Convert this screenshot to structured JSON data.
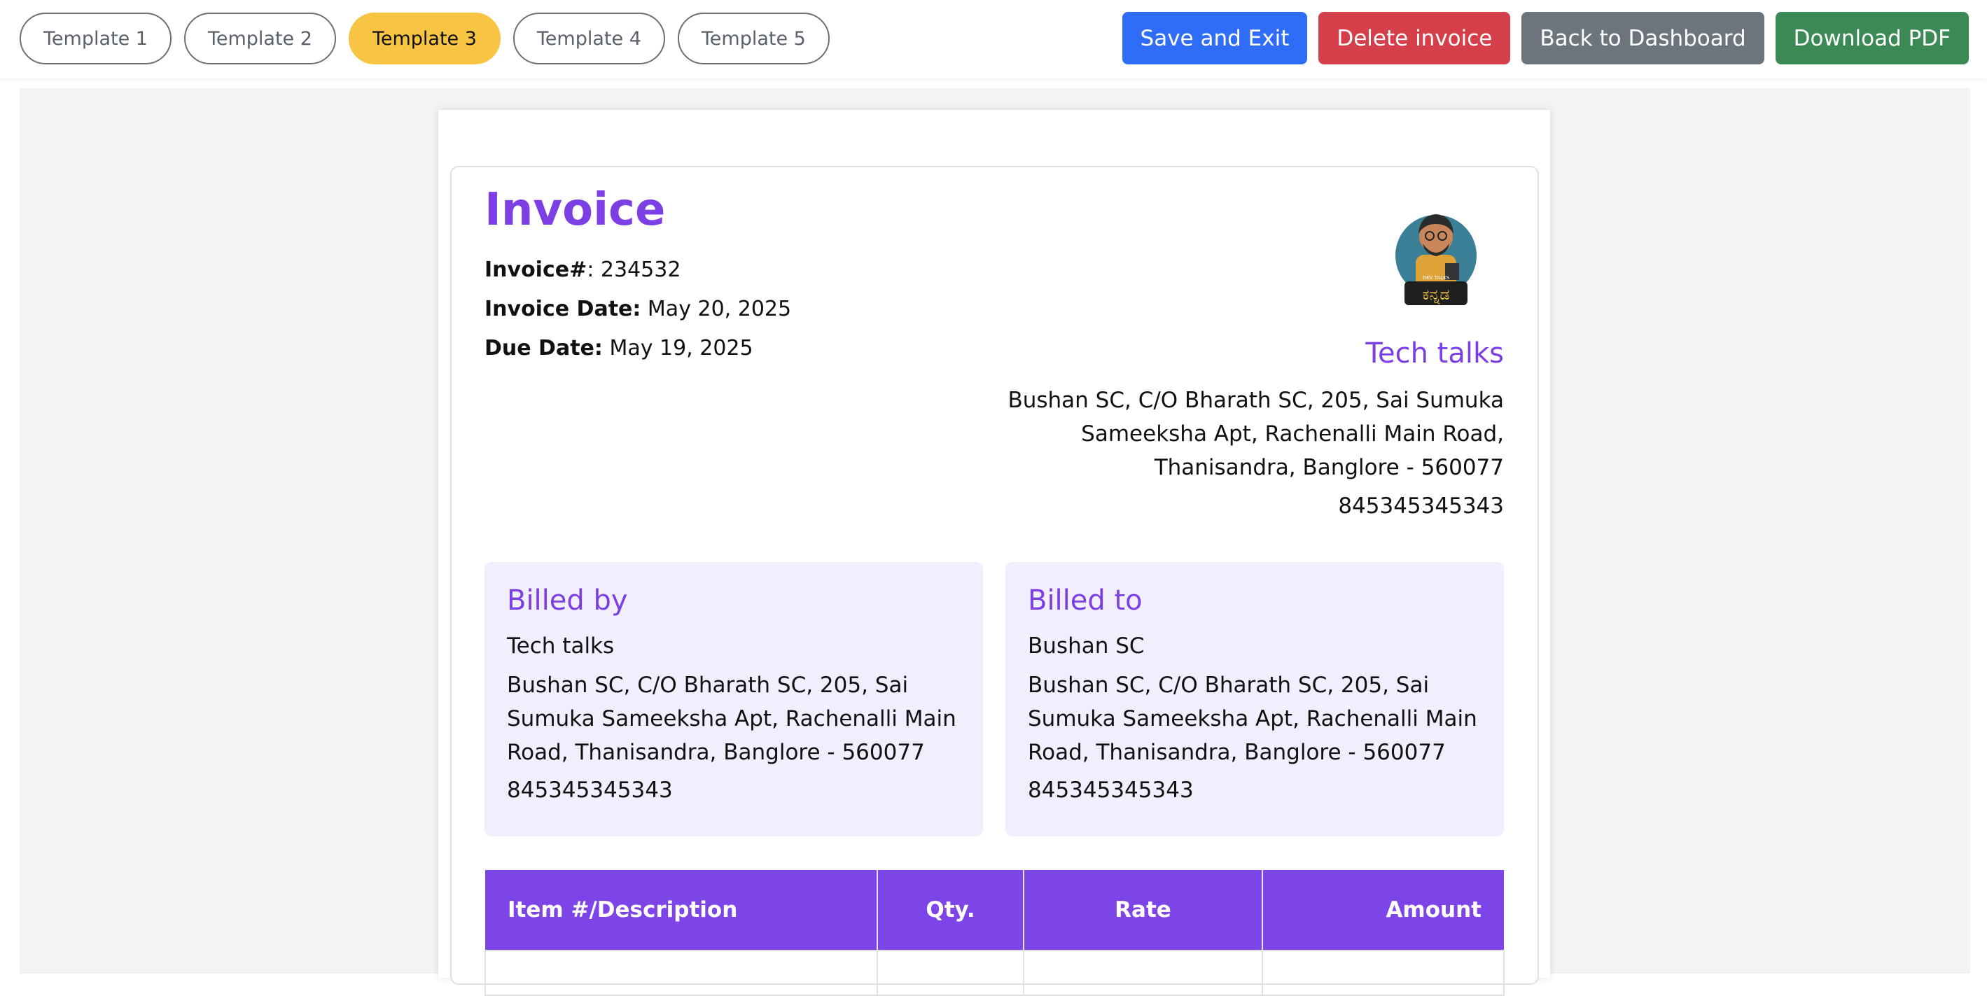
{
  "templates": [
    "Template 1",
    "Template 2",
    "Template 3",
    "Template 4",
    "Template 5"
  ],
  "active_template": "Template 3",
  "actions": {
    "save_exit": "Save and Exit",
    "delete_invoice": "Delete invoice",
    "back_dashboard": "Back to Dashboard",
    "download_pdf": "Download PDF"
  },
  "invoice": {
    "title": "Invoice",
    "number_label": "Invoice#",
    "number": "234532",
    "date_label": "Invoice Date:",
    "date": "May 20, 2025",
    "due_label": "Due Date:",
    "due": "May 19, 2025"
  },
  "company": {
    "name": "Tech talks",
    "address": "Bushan SC, C/O Bharath SC, 205, Sai Sumuka Sameeksha Apt, Rachenalli Main Road, Thanisandra, Banglore - 560077",
    "phone": "845345345343",
    "logo_text_top": "DEV TALKS",
    "logo_text": "ಕನ್ನಡ"
  },
  "billed_by": {
    "heading": "Billed by",
    "name": "Tech talks",
    "address": "Bushan SC, C/O Bharath SC, 205, Sai Sumuka Sameeksha Apt, Rachenalli Main Road, Thanisandra, Banglore - 560077",
    "phone": "845345345343"
  },
  "billed_to": {
    "heading": "Billed to",
    "name": "Bushan SC",
    "address": "Bushan SC, C/O Bharath SC, 205, Sai Sumuka Sameeksha Apt, Rachenalli Main Road, Thanisandra, Banglore - 560077",
    "phone": "845345345343"
  },
  "table": {
    "headers": [
      "Item #/Description",
      "Qty.",
      "Rate",
      "Amount"
    ]
  },
  "colors": {
    "accent": "#7b3fe4",
    "active_template": "#f8c444",
    "save": "#2f6df6",
    "delete": "#d43f4a",
    "back": "#6c757d",
    "download": "#3b8a55",
    "bill_bg": "#f1eefd"
  }
}
